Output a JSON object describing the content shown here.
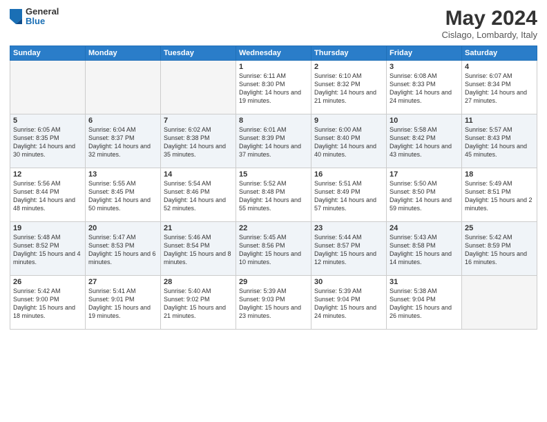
{
  "header": {
    "logo_general": "General",
    "logo_blue": "Blue",
    "month_year": "May 2024",
    "location": "Cislago, Lombardy, Italy"
  },
  "weekdays": [
    "Sunday",
    "Monday",
    "Tuesday",
    "Wednesday",
    "Thursday",
    "Friday",
    "Saturday"
  ],
  "weeks": [
    [
      {
        "day": "",
        "info": ""
      },
      {
        "day": "",
        "info": ""
      },
      {
        "day": "",
        "info": ""
      },
      {
        "day": "1",
        "info": "Sunrise: 6:11 AM\nSunset: 8:30 PM\nDaylight: 14 hours\nand 19 minutes."
      },
      {
        "day": "2",
        "info": "Sunrise: 6:10 AM\nSunset: 8:32 PM\nDaylight: 14 hours\nand 21 minutes."
      },
      {
        "day": "3",
        "info": "Sunrise: 6:08 AM\nSunset: 8:33 PM\nDaylight: 14 hours\nand 24 minutes."
      },
      {
        "day": "4",
        "info": "Sunrise: 6:07 AM\nSunset: 8:34 PM\nDaylight: 14 hours\nand 27 minutes."
      }
    ],
    [
      {
        "day": "5",
        "info": "Sunrise: 6:05 AM\nSunset: 8:35 PM\nDaylight: 14 hours\nand 30 minutes."
      },
      {
        "day": "6",
        "info": "Sunrise: 6:04 AM\nSunset: 8:37 PM\nDaylight: 14 hours\nand 32 minutes."
      },
      {
        "day": "7",
        "info": "Sunrise: 6:02 AM\nSunset: 8:38 PM\nDaylight: 14 hours\nand 35 minutes."
      },
      {
        "day": "8",
        "info": "Sunrise: 6:01 AM\nSunset: 8:39 PM\nDaylight: 14 hours\nand 37 minutes."
      },
      {
        "day": "9",
        "info": "Sunrise: 6:00 AM\nSunset: 8:40 PM\nDaylight: 14 hours\nand 40 minutes."
      },
      {
        "day": "10",
        "info": "Sunrise: 5:58 AM\nSunset: 8:42 PM\nDaylight: 14 hours\nand 43 minutes."
      },
      {
        "day": "11",
        "info": "Sunrise: 5:57 AM\nSunset: 8:43 PM\nDaylight: 14 hours\nand 45 minutes."
      }
    ],
    [
      {
        "day": "12",
        "info": "Sunrise: 5:56 AM\nSunset: 8:44 PM\nDaylight: 14 hours\nand 48 minutes."
      },
      {
        "day": "13",
        "info": "Sunrise: 5:55 AM\nSunset: 8:45 PM\nDaylight: 14 hours\nand 50 minutes."
      },
      {
        "day": "14",
        "info": "Sunrise: 5:54 AM\nSunset: 8:46 PM\nDaylight: 14 hours\nand 52 minutes."
      },
      {
        "day": "15",
        "info": "Sunrise: 5:52 AM\nSunset: 8:48 PM\nDaylight: 14 hours\nand 55 minutes."
      },
      {
        "day": "16",
        "info": "Sunrise: 5:51 AM\nSunset: 8:49 PM\nDaylight: 14 hours\nand 57 minutes."
      },
      {
        "day": "17",
        "info": "Sunrise: 5:50 AM\nSunset: 8:50 PM\nDaylight: 14 hours\nand 59 minutes."
      },
      {
        "day": "18",
        "info": "Sunrise: 5:49 AM\nSunset: 8:51 PM\nDaylight: 15 hours\nand 2 minutes."
      }
    ],
    [
      {
        "day": "19",
        "info": "Sunrise: 5:48 AM\nSunset: 8:52 PM\nDaylight: 15 hours\nand 4 minutes."
      },
      {
        "day": "20",
        "info": "Sunrise: 5:47 AM\nSunset: 8:53 PM\nDaylight: 15 hours\nand 6 minutes."
      },
      {
        "day": "21",
        "info": "Sunrise: 5:46 AM\nSunset: 8:54 PM\nDaylight: 15 hours\nand 8 minutes."
      },
      {
        "day": "22",
        "info": "Sunrise: 5:45 AM\nSunset: 8:56 PM\nDaylight: 15 hours\nand 10 minutes."
      },
      {
        "day": "23",
        "info": "Sunrise: 5:44 AM\nSunset: 8:57 PM\nDaylight: 15 hours\nand 12 minutes."
      },
      {
        "day": "24",
        "info": "Sunrise: 5:43 AM\nSunset: 8:58 PM\nDaylight: 15 hours\nand 14 minutes."
      },
      {
        "day": "25",
        "info": "Sunrise: 5:42 AM\nSunset: 8:59 PM\nDaylight: 15 hours\nand 16 minutes."
      }
    ],
    [
      {
        "day": "26",
        "info": "Sunrise: 5:42 AM\nSunset: 9:00 PM\nDaylight: 15 hours\nand 18 minutes."
      },
      {
        "day": "27",
        "info": "Sunrise: 5:41 AM\nSunset: 9:01 PM\nDaylight: 15 hours\nand 19 minutes."
      },
      {
        "day": "28",
        "info": "Sunrise: 5:40 AM\nSunset: 9:02 PM\nDaylight: 15 hours\nand 21 minutes."
      },
      {
        "day": "29",
        "info": "Sunrise: 5:39 AM\nSunset: 9:03 PM\nDaylight: 15 hours\nand 23 minutes."
      },
      {
        "day": "30",
        "info": "Sunrise: 5:39 AM\nSunset: 9:04 PM\nDaylight: 15 hours\nand 24 minutes."
      },
      {
        "day": "31",
        "info": "Sunrise: 5:38 AM\nSunset: 9:04 PM\nDaylight: 15 hours\nand 26 minutes."
      },
      {
        "day": "",
        "info": ""
      }
    ]
  ]
}
